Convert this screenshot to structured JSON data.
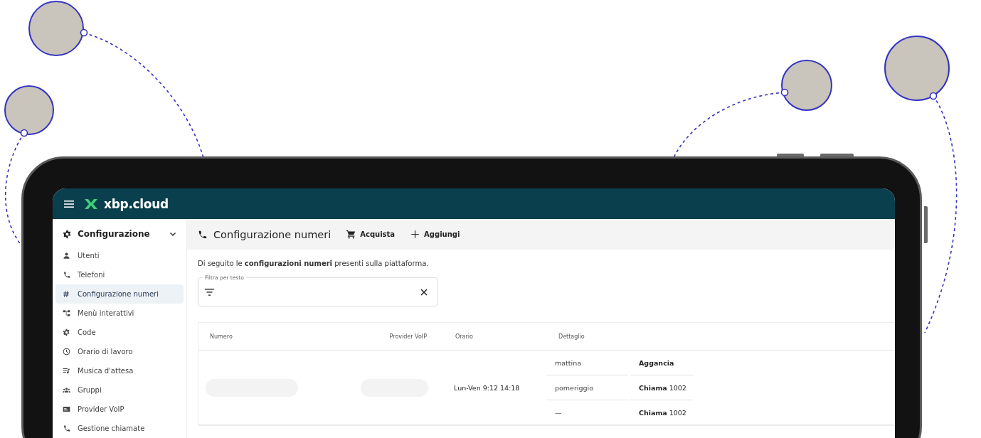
{
  "header": {
    "logo": "xbp.cloud"
  },
  "sidebar": {
    "section": {
      "label": "Configurazione",
      "expanded": true
    },
    "items": [
      {
        "label": "Utenti",
        "kind": "person",
        "selected": false
      },
      {
        "label": "Telefoni",
        "kind": "phone",
        "selected": false
      },
      {
        "label": "Configurazione numeri",
        "kind": "hash",
        "selected": true
      },
      {
        "label": "Menù interattivi",
        "kind": "tree",
        "selected": false
      },
      {
        "label": "Code",
        "kind": "gear",
        "selected": false
      },
      {
        "label": "Orario di lavoro",
        "kind": "clock",
        "selected": false
      },
      {
        "label": "Musica d'attesa",
        "kind": "playlist",
        "selected": false
      },
      {
        "label": "Gruppi",
        "kind": "group",
        "selected": false
      },
      {
        "label": "Provider VoIP",
        "kind": "card",
        "selected": false
      },
      {
        "label": "Gestione chiamate",
        "kind": "phone",
        "selected": false
      }
    ]
  },
  "toolbar": {
    "title": "Configurazione numeri",
    "actions": [
      {
        "label": "Acquista",
        "kind": "cart"
      },
      {
        "label": "Aggiungi",
        "kind": "plus"
      }
    ]
  },
  "description": "Di seguito le **configurazioni numeri** presenti sulla piattaforma.",
  "filter": {
    "label": "Filtra per testo"
  },
  "table": {
    "columns": [
      "Numero",
      "Provider VoIP",
      "Orario",
      "Dettaglio"
    ],
    "rows": [
      {
        "number_loading": true,
        "provider_loading": true,
        "schedule": "Lun-Ven 9:12 14:18",
        "details": [
          {
            "slot": "mattina",
            "action": "**Aggancia**"
          },
          {
            "slot": "pomeriggio",
            "action": "**Chiama** 1002"
          },
          {
            "slot": "—",
            "action": "**Chiama** 1002"
          }
        ]
      }
    ]
  }
}
